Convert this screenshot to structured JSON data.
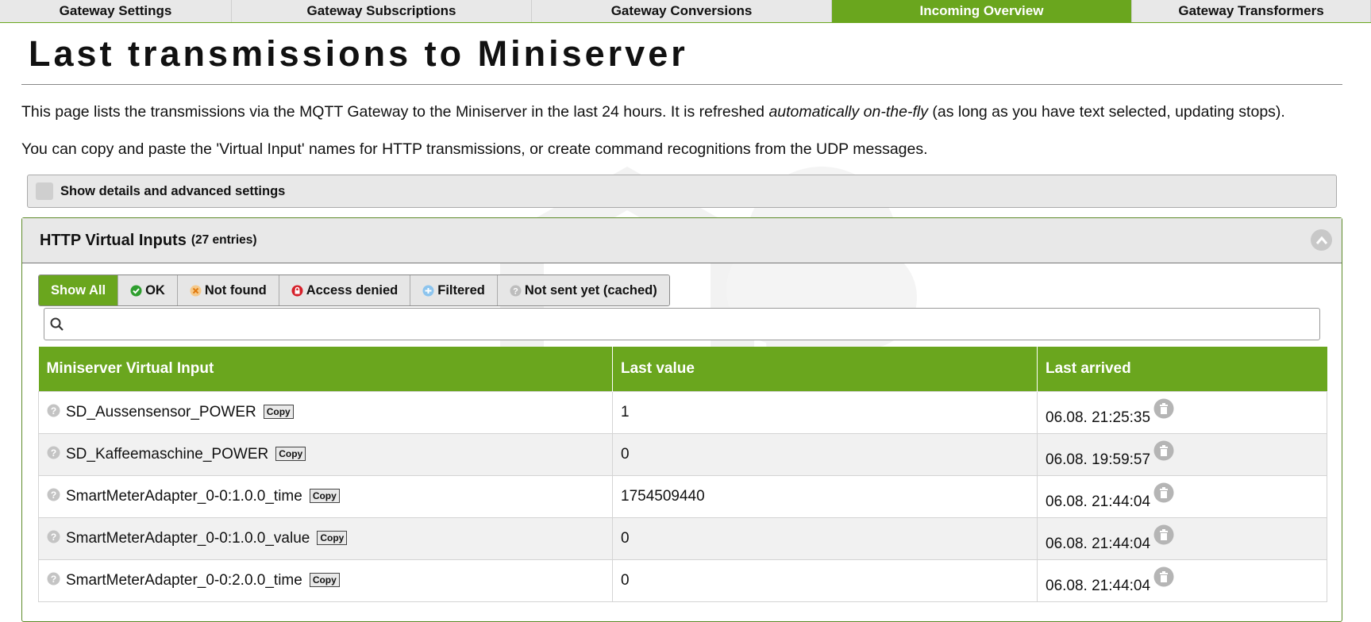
{
  "tabs": [
    {
      "label": "Gateway Settings",
      "active": false
    },
    {
      "label": "Gateway Subscriptions",
      "active": false
    },
    {
      "label": "Gateway Conversions",
      "active": false
    },
    {
      "label": "Incoming Overview",
      "active": true
    },
    {
      "label": "Gateway Transformers",
      "active": false
    }
  ],
  "page": {
    "title": "Last transmissions to Miniserver",
    "intro_before": "This page lists the transmissions via the MQTT Gateway to the Miniserver in the last 24 hours. It is refreshed ",
    "intro_emphasis": "automatically on-the-fly",
    "intro_after": " (as long as you have text selected, updating stops).",
    "intro2": "You can copy and paste the 'Virtual Input' names for HTTP transmissions, or create command recognitions from the UDP messages."
  },
  "advanced": {
    "label": "Show details and advanced settings",
    "checked": false
  },
  "http_panel": {
    "title": "HTTP Virtual Inputs",
    "count": "(27 entries)",
    "filters": [
      {
        "label": "Show All",
        "icon": "",
        "active": true
      },
      {
        "label": "OK",
        "icon": "check-circle-icon",
        "active": false
      },
      {
        "label": "Not found",
        "icon": "x-circle-icon",
        "active": false
      },
      {
        "label": "Access denied",
        "icon": "lock-icon",
        "active": false
      },
      {
        "label": "Filtered",
        "icon": "filter-circle-icon",
        "active": false
      },
      {
        "label": "Not sent yet (cached)",
        "icon": "question-circle-icon",
        "active": false
      }
    ],
    "search": {
      "value": "",
      "placeholder": ""
    },
    "columns": [
      "Miniserver Virtual Input",
      "Last value",
      "Last arrived"
    ],
    "copy_label": "Copy",
    "rows": [
      {
        "name": "SD_Aussensensor_POWER",
        "value": "1",
        "arrived": "06.08. 21:25:35"
      },
      {
        "name": "SD_Kaffeemaschine_POWER",
        "value": "0",
        "arrived": "06.08. 19:59:57"
      },
      {
        "name": "SmartMeterAdapter_0-0:1.0.0_time",
        "value": "1754509440",
        "arrived": "06.08. 21:44:04"
      },
      {
        "name": "SmartMeterAdapter_0-0:1.0.0_value",
        "value": "0",
        "arrived": "06.08. 21:44:04"
      },
      {
        "name": "SmartMeterAdapter_0-0:2.0.0_time",
        "value": "0",
        "arrived": "06.08. 21:44:04"
      }
    ]
  },
  "colors": {
    "accent": "#6aa61e",
    "panel_bg": "#e8e8e8",
    "ok": "#2e9e2e",
    "denied": "#d6202a",
    "notfound": "#f0a040",
    "filtered": "#5aa8e0"
  }
}
